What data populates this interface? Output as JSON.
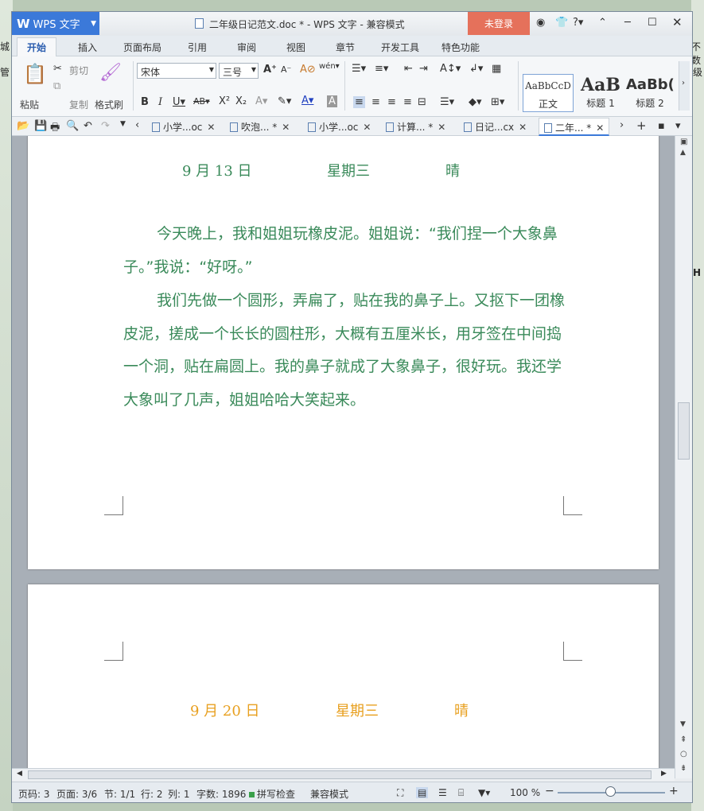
{
  "background": {
    "left_fragments": [
      "城",
      "管"
    ],
    "right_fragments": [
      "不数",
      "级",
      "H"
    ]
  },
  "titlebar": {
    "app_button": "WPS 文字",
    "title": "二年级日记范文.doc * - WPS 文字 - 兼容模式",
    "login": "未登录"
  },
  "ribbon_tabs": [
    "开始",
    "插入",
    "页面布局",
    "引用",
    "审阅",
    "视图",
    "章节",
    "开发工具",
    "特色功能"
  ],
  "ribbon": {
    "paste": "粘贴",
    "cut": "剪切",
    "copy": "复制",
    "format_painter": "格式刷",
    "font_name": "宋体",
    "font_size": "三号",
    "styles": [
      {
        "sample": "AaBbCcD",
        "name": "正文"
      },
      {
        "sample": "AaB",
        "name": "标题 1"
      },
      {
        "sample": "AaBb(",
        "name": "标题 2"
      }
    ]
  },
  "doc_tabs": [
    {
      "label": "小学...oc",
      "modified": false
    },
    {
      "label": "吹泡... *",
      "modified": true
    },
    {
      "label": "小学...oc",
      "modified": false
    },
    {
      "label": "计算... *",
      "modified": true
    },
    {
      "label": "日记...cx",
      "modified": false
    },
    {
      "label": "二年... *",
      "modified": true,
      "active": true
    }
  ],
  "document": {
    "entry1": {
      "date": "9 月 13 日",
      "weekday": "星期三",
      "weather": "晴",
      "paragraph1": "今天晚上，我和姐姐玩橡皮泥。姐姐说：“我们捏一个大象鼻子。”我说：“好呀。”",
      "paragraph2": "我们先做一个圆形，弄扁了，贴在我的鼻子上。又抠下一团橡皮泥，搓成一个长长的圆柱形，大概有五厘米长，用牙签在中间捣一个洞，贴在扁圆上。我的鼻子就成了大象鼻子，很好玩。我还学大象叫了几声，姐姐哈哈大笑起来。"
    },
    "entry2": {
      "date": "9 月 20 日",
      "weekday": "星期三",
      "weather": "晴"
    }
  },
  "statusbar": {
    "page_no": "页码: 3",
    "pages": "页面: 3/6",
    "section": "节: 1/1",
    "line": "行: 2",
    "column": "列: 1",
    "word_count": "字数: 1896",
    "spell_check": "拼写检查",
    "compat_mode": "兼容模式",
    "zoom": "100 %"
  },
  "colors": {
    "accent": "#3b79d9",
    "login": "#e5715b",
    "text_green": "#3a8a5a",
    "text_orange": "#e8a020"
  }
}
